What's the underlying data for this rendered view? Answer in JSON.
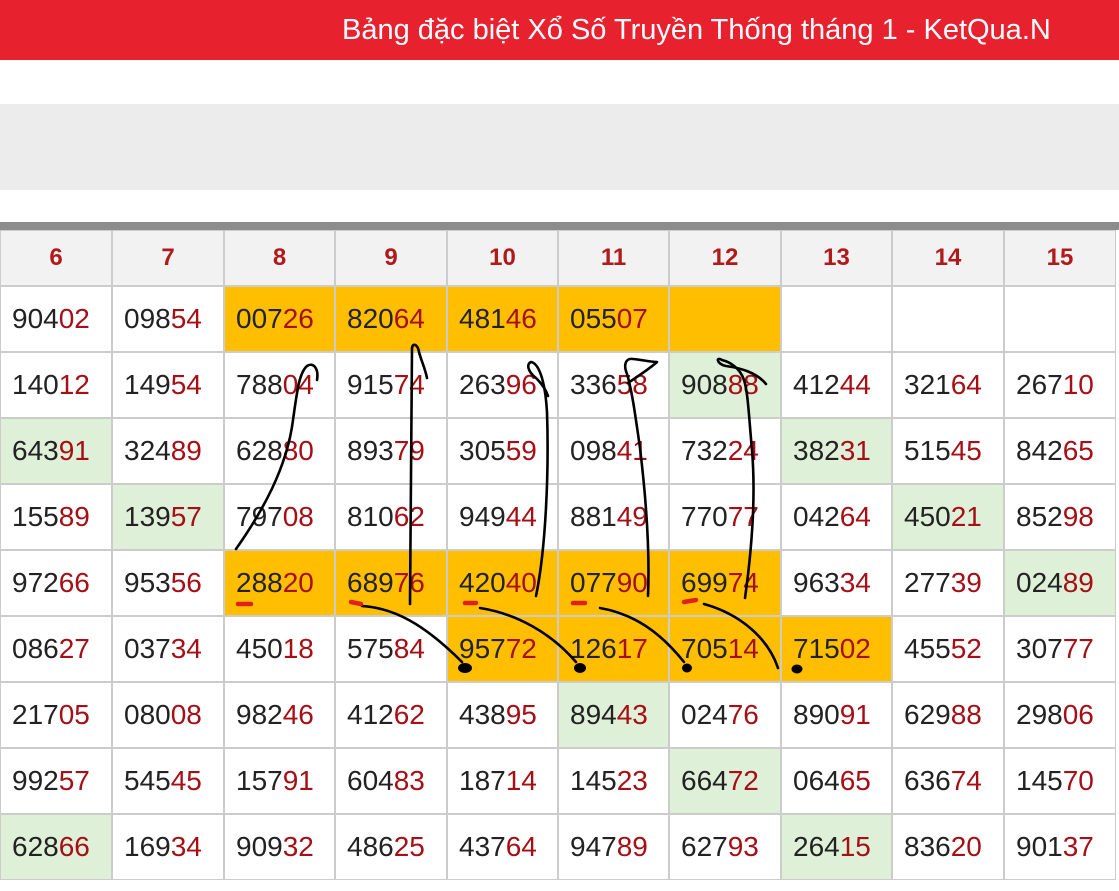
{
  "header": {
    "title": "Bảng đặc biệt Xổ Số Truyền Thống tháng 1 - KetQua.N"
  },
  "colors": {
    "brand_red": "#e8212f",
    "digit_red": "#a50f15",
    "highlight_gold": "#ffbe00",
    "highlight_green": "#dff0d8",
    "ink": "#000000",
    "ink_red": "#e0201c"
  },
  "table": {
    "columns": [
      "6",
      "7",
      "8",
      "9",
      "10",
      "11",
      "12",
      "13",
      "14",
      "15"
    ],
    "rows": [
      [
        {
          "head": "904",
          "tail": "02"
        },
        {
          "head": "098",
          "tail": "54"
        },
        {
          "head": "007",
          "tail": "26",
          "hl": "gold"
        },
        {
          "head": "820",
          "tail": "64",
          "hl": "gold"
        },
        {
          "head": "481",
          "tail": "46",
          "hl": "gold"
        },
        {
          "head": "055",
          "tail": "07",
          "hl": "gold"
        },
        {
          "head": "",
          "tail": "",
          "hl": "gold"
        },
        {
          "head": "",
          "tail": ""
        },
        {
          "head": "",
          "tail": ""
        },
        {
          "head": "",
          "tail": ""
        }
      ],
      [
        {
          "head": "140",
          "tail": "12"
        },
        {
          "head": "149",
          "tail": "54"
        },
        {
          "head": "788",
          "tail": "04"
        },
        {
          "head": "915",
          "tail": "74"
        },
        {
          "head": "263",
          "tail": "96"
        },
        {
          "head": "336",
          "tail": "58"
        },
        {
          "head": "908",
          "tail": "88",
          "hl": "green"
        },
        {
          "head": "412",
          "tail": "44"
        },
        {
          "head": "321",
          "tail": "64"
        },
        {
          "head": "267",
          "tail": "10"
        }
      ],
      [
        {
          "head": "643",
          "tail": "91",
          "hl": "green"
        },
        {
          "head": "324",
          "tail": "89"
        },
        {
          "head": "628",
          "tail": "80"
        },
        {
          "head": "893",
          "tail": "79"
        },
        {
          "head": "305",
          "tail": "59"
        },
        {
          "head": "098",
          "tail": "41"
        },
        {
          "head": "732",
          "tail": "24"
        },
        {
          "head": "382",
          "tail": "31",
          "hl": "green"
        },
        {
          "head": "515",
          "tail": "45"
        },
        {
          "head": "842",
          "tail": "65"
        }
      ],
      [
        {
          "head": "155",
          "tail": "89"
        },
        {
          "head": "139",
          "tail": "57",
          "hl": "green"
        },
        {
          "head": "797",
          "tail": "08"
        },
        {
          "head": "810",
          "tail": "62"
        },
        {
          "head": "949",
          "tail": "44"
        },
        {
          "head": "881",
          "tail": "49"
        },
        {
          "head": "770",
          "tail": "77"
        },
        {
          "head": "042",
          "tail": "64"
        },
        {
          "head": "450",
          "tail": "21",
          "hl": "green"
        },
        {
          "head": "852",
          "tail": "98"
        }
      ],
      [
        {
          "head": "972",
          "tail": "66"
        },
        {
          "head": "953",
          "tail": "56"
        },
        {
          "head": "288",
          "tail": "20",
          "hl": "gold"
        },
        {
          "head": "689",
          "tail": "76",
          "hl": "gold"
        },
        {
          "head": "420",
          "tail": "40",
          "hl": "gold"
        },
        {
          "head": "077",
          "tail": "90",
          "hl": "gold"
        },
        {
          "head": "699",
          "tail": "74",
          "hl": "gold"
        },
        {
          "head": "963",
          "tail": "34"
        },
        {
          "head": "277",
          "tail": "39"
        },
        {
          "head": "024",
          "tail": "89",
          "hl": "green"
        }
      ],
      [
        {
          "head": "086",
          "tail": "27"
        },
        {
          "head": "037",
          "tail": "34"
        },
        {
          "head": "450",
          "tail": "18"
        },
        {
          "head": "575",
          "tail": "84"
        },
        {
          "head": "957",
          "tail": "72",
          "hl": "gold"
        },
        {
          "head": "126",
          "tail": "17",
          "hl": "gold"
        },
        {
          "head": "705",
          "tail": "14",
          "hl": "gold"
        },
        {
          "head": "715",
          "tail": "02",
          "hl": "gold"
        },
        {
          "head": "455",
          "tail": "52"
        },
        {
          "head": "307",
          "tail": "77"
        }
      ],
      [
        {
          "head": "217",
          "tail": "05"
        },
        {
          "head": "080",
          "tail": "08"
        },
        {
          "head": "982",
          "tail": "46"
        },
        {
          "head": "412",
          "tail": "62"
        },
        {
          "head": "438",
          "tail": "95"
        },
        {
          "head": "894",
          "tail": "43",
          "hl": "green"
        },
        {
          "head": "024",
          "tail": "76"
        },
        {
          "head": "890",
          "tail": "91"
        },
        {
          "head": "629",
          "tail": "88"
        },
        {
          "head": "298",
          "tail": "06"
        }
      ],
      [
        {
          "head": "992",
          "tail": "57"
        },
        {
          "head": "545",
          "tail": "45"
        },
        {
          "head": "157",
          "tail": "91"
        },
        {
          "head": "604",
          "tail": "83"
        },
        {
          "head": "187",
          "tail": "14"
        },
        {
          "head": "145",
          "tail": "23"
        },
        {
          "head": "664",
          "tail": "72",
          "hl": "green"
        },
        {
          "head": "064",
          "tail": "65"
        },
        {
          "head": "636",
          "tail": "74"
        },
        {
          "head": "145",
          "tail": "70"
        }
      ],
      [
        {
          "head": "628",
          "tail": "66",
          "hl": "green"
        },
        {
          "head": "169",
          "tail": "34"
        },
        {
          "head": "909",
          "tail": "32"
        },
        {
          "head": "486",
          "tail": "25"
        },
        {
          "head": "437",
          "tail": "64"
        },
        {
          "head": "947",
          "tail": "89"
        },
        {
          "head": "627",
          "tail": "93"
        },
        {
          "head": "264",
          "tail": "15",
          "hl": "green"
        },
        {
          "head": "836",
          "tail": "20"
        },
        {
          "head": "901",
          "tail": "37"
        }
      ]
    ]
  }
}
